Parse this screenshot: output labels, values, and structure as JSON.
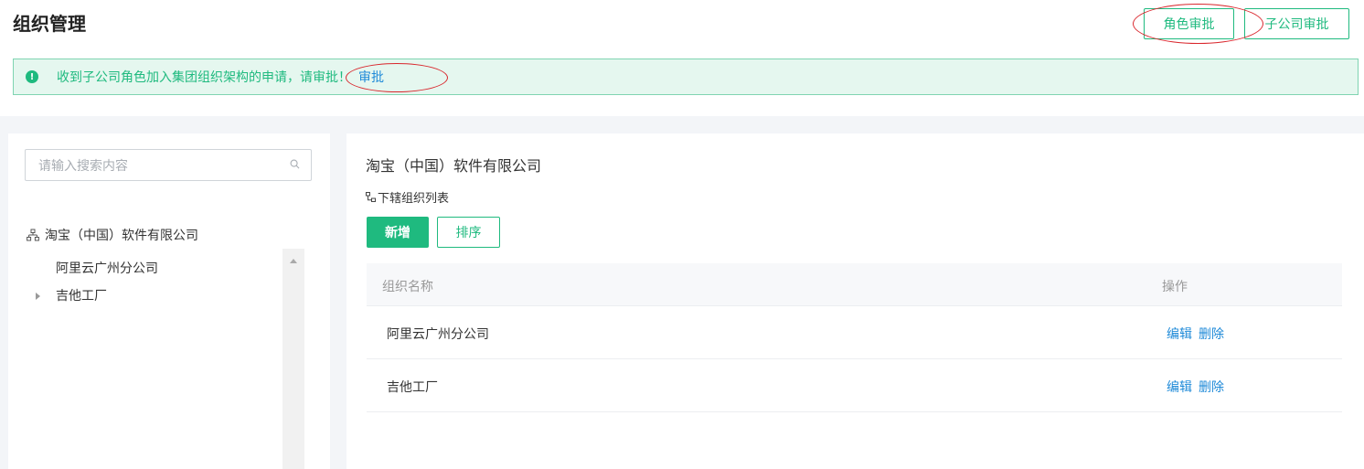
{
  "header": {
    "title": "组织管理",
    "buttons": {
      "role_approve": "角色审批",
      "subsidiary_approve": "子公司审批"
    }
  },
  "alert": {
    "icon": "info-icon",
    "message": "收到子公司角色加入集团组织架构的申请，请审批！",
    "link": "审批"
  },
  "sidebar": {
    "search_placeholder": "请输入搜索内容",
    "root": "淘宝（中国）软件有限公司",
    "items": [
      {
        "label": "阿里云广州分公司",
        "expandable": false
      },
      {
        "label": "吉他工厂",
        "expandable": true
      }
    ]
  },
  "main": {
    "company": "淘宝（中国）软件有限公司",
    "sub_list_label": "下辖组织列表",
    "add_button": "新增",
    "sort_button": "排序",
    "table": {
      "columns": [
        "组织名称",
        "操作"
      ],
      "rows": [
        {
          "name": "阿里云广州分公司",
          "actions": [
            "编辑",
            "删除"
          ]
        },
        {
          "name": "吉他工厂",
          "actions": [
            "编辑",
            "删除"
          ]
        }
      ]
    }
  },
  "colors": {
    "accent": "#1fba7f",
    "link": "#1f8ad8",
    "annotation_ring": "#d9262c",
    "alert_bg": "#e5f7ef"
  }
}
